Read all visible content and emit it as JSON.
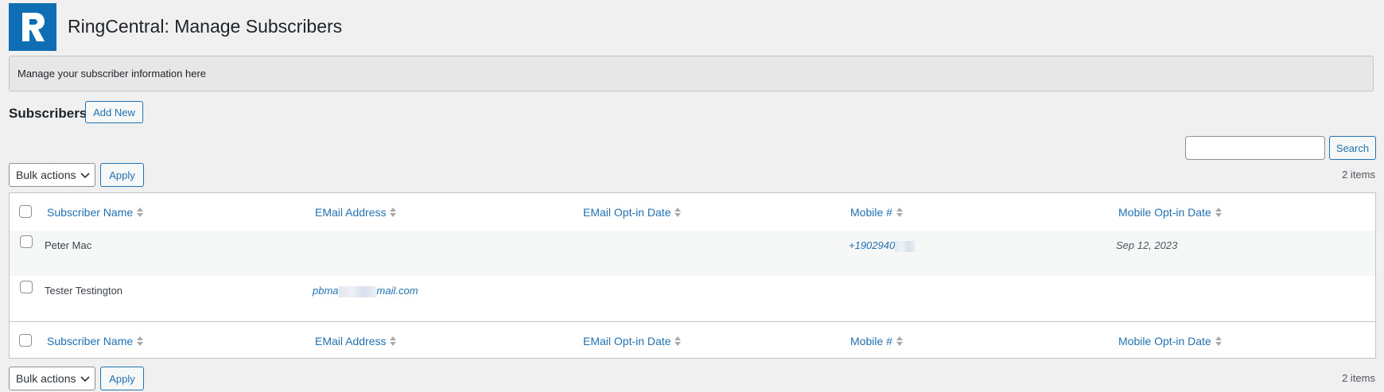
{
  "header": {
    "title": "RingCentral: Manage Subscribers",
    "logo_icon": "ringcentral-logo",
    "brand_color": "#0e6db3"
  },
  "notice": {
    "text": "Manage your subscriber information here"
  },
  "subscribers_section": {
    "heading": "Subscribers",
    "add_new_label": "Add New"
  },
  "search": {
    "value": "",
    "button_label": "Search"
  },
  "bulk": {
    "select_label": "Bulk actions",
    "apply_label": "Apply",
    "items_count": "2 items"
  },
  "table": {
    "columns": [
      "Subscriber Name",
      "EMail Address",
      "EMail Opt-in Date",
      "Mobile #",
      "Mobile Opt-in Date"
    ],
    "rows": [
      {
        "name": "Peter Mac",
        "email_prefix": "",
        "email_suffix": "",
        "email_optin": "",
        "mobile": "+1902940",
        "mobile_optin": "Sep 12, 2023"
      },
      {
        "name": "Tester Testington",
        "email_prefix": "pbma",
        "email_suffix": "mail.com",
        "email_optin": "",
        "mobile": "",
        "mobile_optin": ""
      }
    ]
  },
  "colors": {
    "link": "#2271b1",
    "background": "#f0f0f1",
    "border": "#c3c4c7"
  }
}
